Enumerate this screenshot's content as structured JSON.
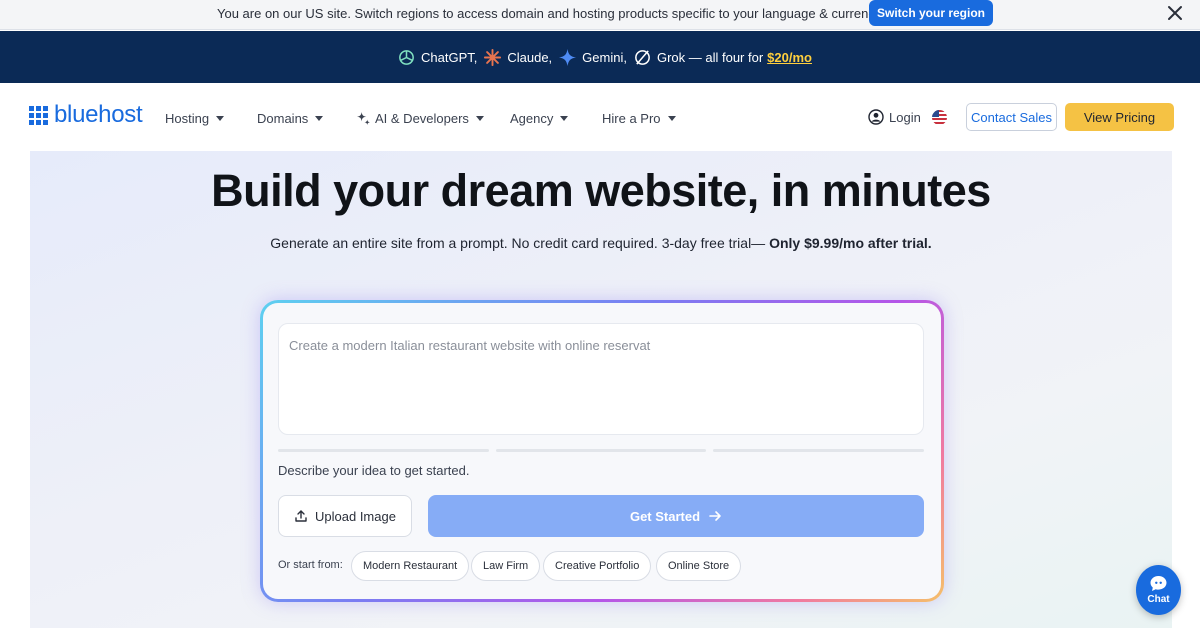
{
  "region_banner": {
    "message": "You are on our US site. Switch regions to access domain and hosting products specific to your language & currency.",
    "switch_button": "Switch your region"
  },
  "promo": {
    "items": [
      "ChatGPT,",
      "Claude,",
      "Gemini,",
      "Grok — all four for"
    ],
    "price": "$20/mo"
  },
  "nav": {
    "logo": "bluehost",
    "menu": [
      {
        "label": "Hosting"
      },
      {
        "label": "Domains"
      },
      {
        "label": "AI & Developers"
      },
      {
        "label": "Agency"
      },
      {
        "label": "Hire a Pro"
      }
    ],
    "login": "Login",
    "contact_sales": "Contact Sales",
    "view_pricing": "View Pricing"
  },
  "hero": {
    "title": "Build your dream website, in minutes",
    "subtitle": "Generate an entire site from a prompt. No credit card required. 3-day free trial— ",
    "subtitle_bold": "Only $9.99/mo after trial.",
    "prompt_placeholder": "Create a modern Italian restaurant website with online reservat",
    "prompt_value": "",
    "describe_hint": "Describe your idea to get started.",
    "upload_button": "Upload Image",
    "get_started_button": "Get Started",
    "start_from_label": "Or start from:",
    "templates": [
      "Modern Restaurant",
      "Law Firm",
      "Creative Portfolio",
      "Online Store"
    ]
  },
  "chat": {
    "label": "Chat"
  },
  "colors": {
    "brand_blue": "#196bde",
    "promo_navy": "#0b2a56",
    "price_yellow": "#ffcf3d",
    "pricing_button": "#f5c244",
    "get_started_disabled": "#86acf6"
  },
  "icons": [
    "close-icon",
    "chatgpt-icon",
    "claude-icon",
    "gemini-icon",
    "grok-icon",
    "caret-down-icon",
    "sparkle-icon",
    "user-icon",
    "us-flag-icon",
    "upload-icon",
    "arrow-right-icon",
    "chat-icon"
  ]
}
